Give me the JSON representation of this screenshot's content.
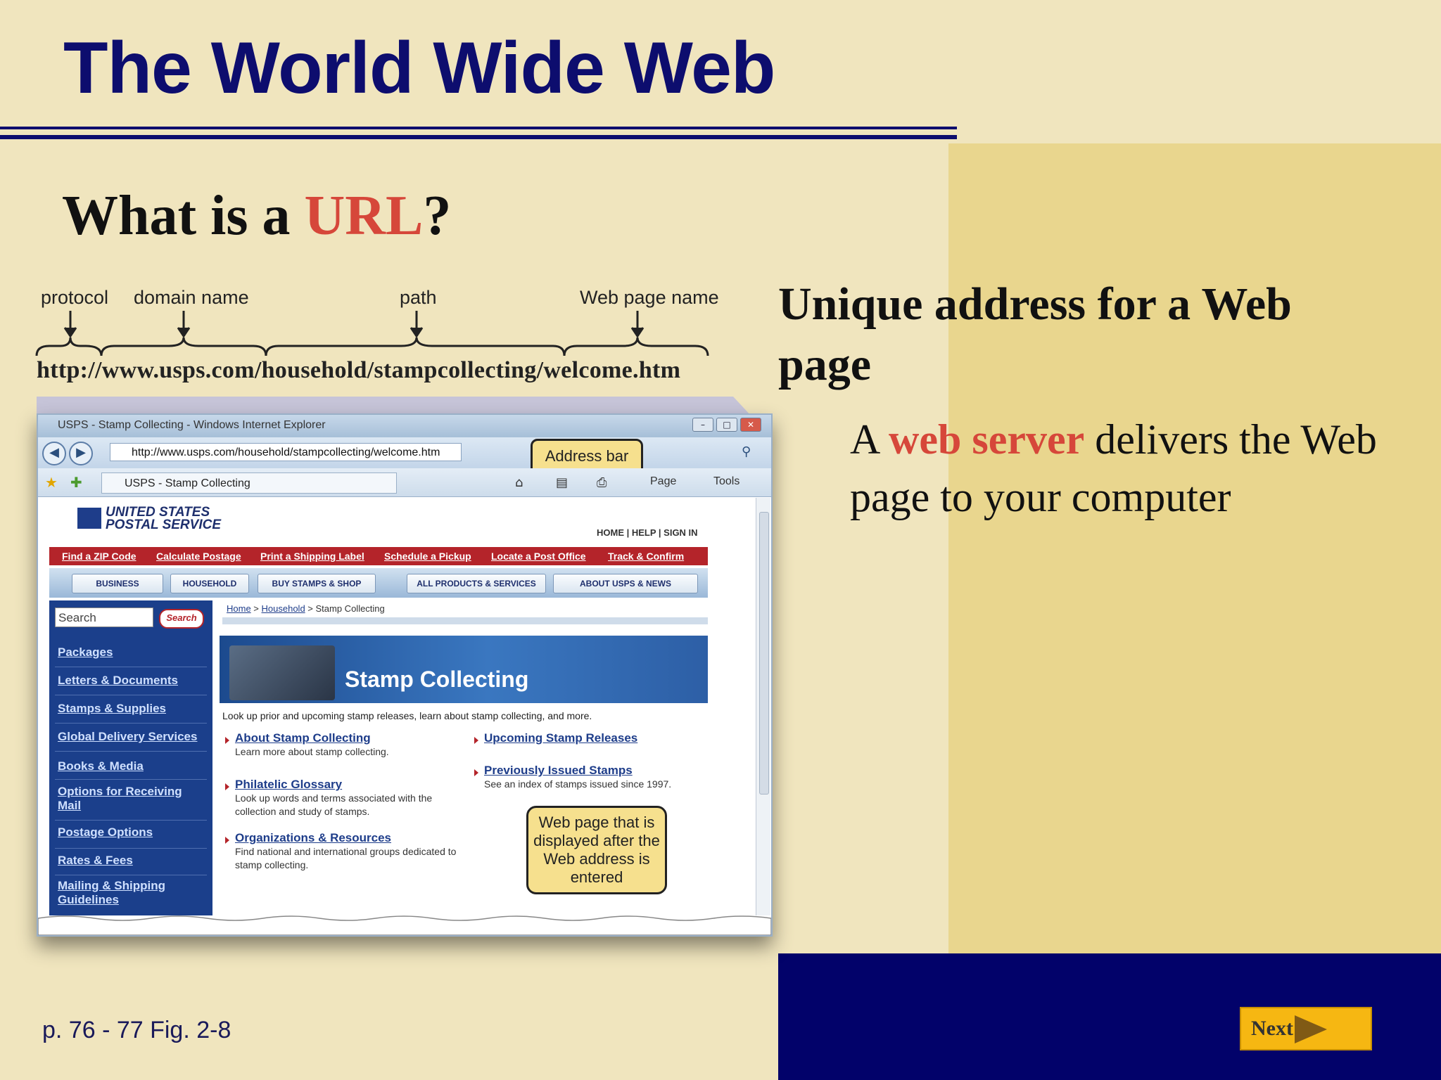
{
  "slide": {
    "title": "The World Wide Web",
    "question_prefix": "What is a ",
    "question_term": "URL",
    "question_suffix": "?",
    "point1": "Unique address for a Web page",
    "point2_prefix": "A ",
    "point2_term": "web server",
    "point2_suffix": " delivers the Web page to your computer",
    "caption": "p. 76 - 77 Fig. 2-8",
    "next_label": "Next"
  },
  "colors": {
    "background": "#f0e5be",
    "title": "#0d0d6e",
    "accent_red": "#d6473a",
    "panel": "#e9d68e",
    "footer_bar": "#02026a",
    "next_button": "#f6b712"
  },
  "diagram": {
    "labels": {
      "protocol": "protocol",
      "domain": "domain name",
      "path": "path",
      "page": "Web page name"
    },
    "url": "http://www.usps.com/household/stampcollecting/welcome.htm"
  },
  "browser": {
    "window_title": "USPS - Stamp Collecting - Windows Internet Explorer",
    "address": "http://www.usps.com/household/stampcollecting/welcome.htm",
    "address_callout": "Address bar",
    "tab_label": "USPS - Stamp Collecting",
    "tools": {
      "page": "Page",
      "tools": "Tools"
    },
    "site": {
      "logo_line1": "UNITED STATES",
      "logo_line2": "POSTAL SERVICE",
      "util_links": "HOME | HELP | SIGN IN",
      "red_links": [
        "Find a ZIP Code",
        "Calculate Postage",
        "Print a Shipping Label",
        "Schedule a Pickup",
        "Locate a Post Office",
        "Track & Confirm"
      ],
      "nav_tabs": [
        "BUSINESS",
        "HOUSEHOLD",
        "BUY STAMPS & SHOP",
        "ALL PRODUCTS & SERVICES",
        "ABOUT USPS & NEWS"
      ],
      "search_placeholder": "Search",
      "search_button": "Search",
      "side_links": [
        "Packages",
        "Letters & Documents",
        "Stamps & Supplies",
        "Global Delivery Services",
        "Books & Media",
        "Options for Receiving Mail",
        "Postage Options",
        "Rates & Fees",
        "Mailing & Shipping Guidelines"
      ],
      "breadcrumb_home": "Home",
      "breadcrumb_household": "Household",
      "breadcrumb_current": "Stamp Collecting",
      "banner_title": "Stamp Collecting",
      "intro": "Look up prior and upcoming stamp releases, learn about stamp collecting, and more.",
      "articles": [
        {
          "title": "About Stamp Collecting",
          "desc": "Learn more about stamp collecting."
        },
        {
          "title": "Philatelic Glossary",
          "desc": "Look up words and terms associated with the collection and study of stamps."
        },
        {
          "title": "Organizations & Resources",
          "desc": "Find national and international groups dedicated to stamp collecting."
        },
        {
          "title": "Upcoming Stamp Releases",
          "desc": ""
        },
        {
          "title": "Previously Issued Stamps",
          "desc": "See an index of stamps issued since 1997."
        }
      ],
      "page_callout": "Web page that is displayed after the Web address is entered"
    }
  }
}
